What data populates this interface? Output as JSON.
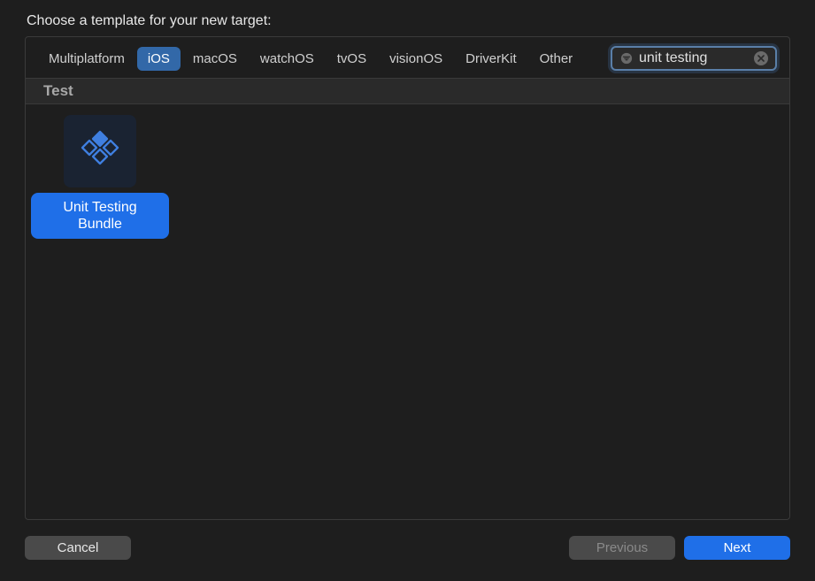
{
  "header": {
    "title": "Choose a template for your new target:"
  },
  "tabs": [
    {
      "label": "Multiplatform",
      "active": false
    },
    {
      "label": "iOS",
      "active": true
    },
    {
      "label": "macOS",
      "active": false
    },
    {
      "label": "watchOS",
      "active": false
    },
    {
      "label": "tvOS",
      "active": false
    },
    {
      "label": "visionOS",
      "active": false
    },
    {
      "label": "DriverKit",
      "active": false
    },
    {
      "label": "Other",
      "active": false
    }
  ],
  "search": {
    "value": "unit testing",
    "placeholder": "Filter"
  },
  "section": {
    "header": "Test"
  },
  "templates": [
    {
      "name": "Unit Testing Bundle",
      "icon": "diamond-grid",
      "selected": true
    }
  ],
  "footer": {
    "cancel": "Cancel",
    "previous": "Previous",
    "next": "Next"
  },
  "colors": {
    "accent": "#1f6fe8",
    "tab_active": "#3268a8"
  }
}
